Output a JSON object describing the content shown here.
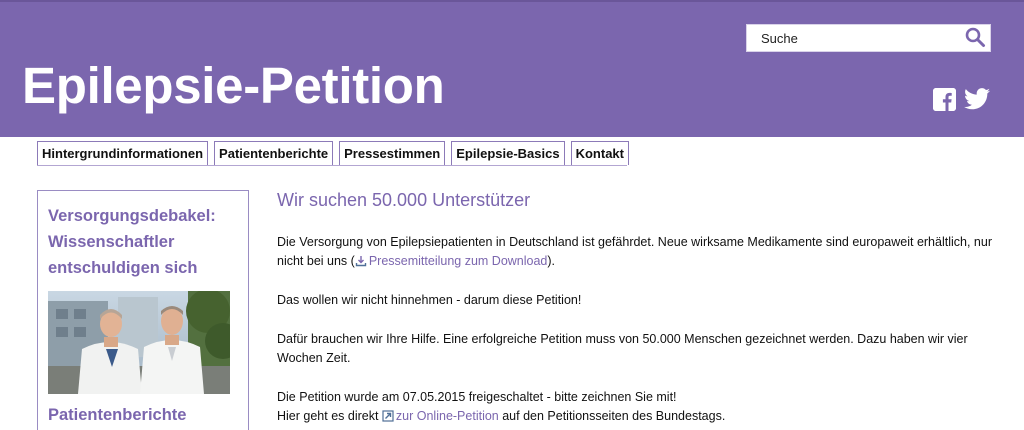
{
  "header": {
    "title": "Epilepsie-Petition",
    "search_placeholder": "Suche",
    "social": [
      "facebook-icon",
      "twitter-icon"
    ]
  },
  "nav": {
    "tabs": [
      "Hintergrundinformationen",
      "Patientenberichte",
      "Pressestimmen",
      "Epilepsie-Basics",
      "Kontakt"
    ]
  },
  "sidebar": {
    "heading": "Versorgungsdebakel: Wissenschaftler entschuldigen sich",
    "heading2": "Patientenberichte"
  },
  "main": {
    "title": "Wir suchen 50.000 Unterstützer",
    "p1_text": "Die Versorgung von Epilepsiepatienten in Deutschland ist gefährdet. Neue wirksame Medikamente sind europaweit erhältlich, nur nicht bei uns (",
    "p1_link": "Pressemitteilung zum Download",
    "p1_end": ").",
    "p2": "Das wollen wir nicht hinnehmen - darum diese Petition!",
    "p3": "Dafür brauchen wir Ihre Hilfe. Eine erfolgreiche Petition muss von 50.000 Menschen gezeichnet werden. Dazu haben wir vier Wochen Zeit.",
    "p4_line1": "Die Petition wurde am 07.05.2015 freigeschaltet - bitte zeichnen Sie mit!",
    "p4_pre": "Hier geht es direkt ",
    "p4_link": "zur Online-Petition",
    "p4_post": " auf den Petitionsseiten des Bundestags."
  },
  "colors": {
    "brand_purple": "#7b66ae",
    "link": "#7b66ae"
  }
}
